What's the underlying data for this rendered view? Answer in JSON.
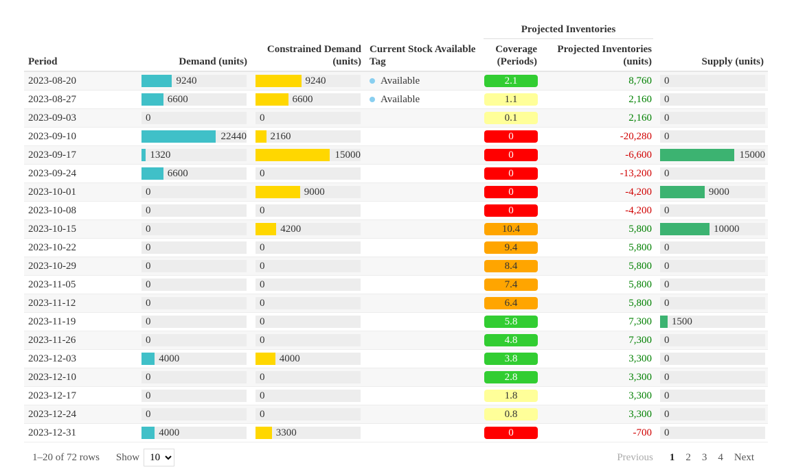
{
  "header": {
    "group": "Projected Inventories",
    "period": "Period",
    "demand": "Demand (units)",
    "constrained": "Constrained Demand (units)",
    "tag": "Current Stock Available Tag",
    "coverage": "Coverage (Periods)",
    "projected": "Projected Inventories (units)",
    "supply": "Supply (units)"
  },
  "colors": {
    "demand": "#40c0c8",
    "constrained": "#ffd700",
    "supply": "#3cb371",
    "dot": "#89cff0",
    "cov_red": "#ff0000",
    "cov_yellow": "#ffff99",
    "cov_green": "#32cd32",
    "cov_orange": "#ffa500",
    "pos": "#008000",
    "neg": "#d00000"
  },
  "rows": [
    {
      "period": "2023-08-20",
      "demand": 9240,
      "constrained": 9240,
      "tag": "Available",
      "coverage": "2.1",
      "projected": "8,760",
      "supply": 0
    },
    {
      "period": "2023-08-27",
      "demand": 6600,
      "constrained": 6600,
      "tag": "Available",
      "coverage": "1.1",
      "projected": "2,160",
      "supply": 0
    },
    {
      "period": "2023-09-03",
      "demand": 0,
      "constrained": 0,
      "tag": "",
      "coverage": "0.1",
      "projected": "2,160",
      "supply": 0
    },
    {
      "period": "2023-09-10",
      "demand": 22440,
      "constrained": 2160,
      "tag": "",
      "coverage": "0",
      "projected": "-20,280",
      "supply": 0
    },
    {
      "period": "2023-09-17",
      "demand": 1320,
      "constrained": 15000,
      "tag": "",
      "coverage": "0",
      "projected": "-6,600",
      "supply": 15000
    },
    {
      "period": "2023-09-24",
      "demand": 6600,
      "constrained": 0,
      "tag": "",
      "coverage": "0",
      "projected": "-13,200",
      "supply": 0
    },
    {
      "period": "2023-10-01",
      "demand": 0,
      "constrained": 9000,
      "tag": "",
      "coverage": "0",
      "projected": "-4,200",
      "supply": 9000
    },
    {
      "period": "2023-10-08",
      "demand": 0,
      "constrained": 0,
      "tag": "",
      "coverage": "0",
      "projected": "-4,200",
      "supply": 0
    },
    {
      "period": "2023-10-15",
      "demand": 0,
      "constrained": 4200,
      "tag": "",
      "coverage": "10.4",
      "projected": "5,800",
      "supply": 10000
    },
    {
      "period": "2023-10-22",
      "demand": 0,
      "constrained": 0,
      "tag": "",
      "coverage": "9.4",
      "projected": "5,800",
      "supply": 0
    },
    {
      "period": "2023-10-29",
      "demand": 0,
      "constrained": 0,
      "tag": "",
      "coverage": "8.4",
      "projected": "5,800",
      "supply": 0
    },
    {
      "period": "2023-11-05",
      "demand": 0,
      "constrained": 0,
      "tag": "",
      "coverage": "7.4",
      "projected": "5,800",
      "supply": 0
    },
    {
      "period": "2023-11-12",
      "demand": 0,
      "constrained": 0,
      "tag": "",
      "coverage": "6.4",
      "projected": "5,800",
      "supply": 0
    },
    {
      "period": "2023-11-19",
      "demand": 0,
      "constrained": 0,
      "tag": "",
      "coverage": "5.8",
      "projected": "7,300",
      "supply": 1500
    },
    {
      "period": "2023-11-26",
      "demand": 0,
      "constrained": 0,
      "tag": "",
      "coverage": "4.8",
      "projected": "7,300",
      "supply": 0
    },
    {
      "period": "2023-12-03",
      "demand": 4000,
      "constrained": 4000,
      "tag": "",
      "coverage": "3.8",
      "projected": "3,300",
      "supply": 0
    },
    {
      "period": "2023-12-10",
      "demand": 0,
      "constrained": 0,
      "tag": "",
      "coverage": "2.8",
      "projected": "3,300",
      "supply": 0
    },
    {
      "period": "2023-12-17",
      "demand": 0,
      "constrained": 0,
      "tag": "",
      "coverage": "1.8",
      "projected": "3,300",
      "supply": 0
    },
    {
      "period": "2023-12-24",
      "demand": 0,
      "constrained": 0,
      "tag": "",
      "coverage": "0.8",
      "projected": "3,300",
      "supply": 0
    },
    {
      "period": "2023-12-31",
      "demand": 4000,
      "constrained": 3300,
      "tag": "",
      "coverage": "0",
      "projected": "-700",
      "supply": 0
    }
  ],
  "footer": {
    "range": "1–20 of 72 rows",
    "show": "Show",
    "page_size": "10",
    "previous": "Previous",
    "pages": [
      "1",
      "2",
      "3",
      "4"
    ],
    "next": "Next",
    "current_page": "1"
  }
}
